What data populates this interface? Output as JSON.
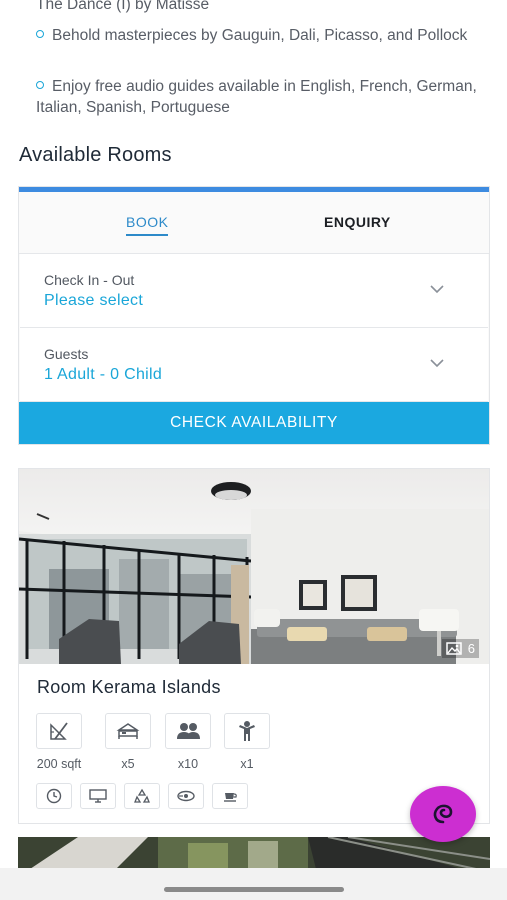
{
  "intro": {
    "top_line": "The Dance (I) by Matisse",
    "bullets": [
      "Behold masterpieces by Gauguin, Dali, Picasso, and Pollock",
      "Enjoy free audio guides available in English, French, German, Italian, Spanish, Portuguese"
    ]
  },
  "section_title": "Available Rooms",
  "booking": {
    "tabs": {
      "book": "BOOK",
      "enquiry": "ENQUIRY"
    },
    "active_tab": "BOOK",
    "check_in_out": {
      "label": "Check In - Out",
      "value": "Please select"
    },
    "guests": {
      "label": "Guests",
      "value": "1 Adult - 0 Child"
    },
    "check_button": "CHECK AVAILABILITY"
  },
  "room": {
    "name": "Room Kerama Islands",
    "photo_count": "6",
    "specs": [
      {
        "icon": "area-icon",
        "caption": "200 sqft"
      },
      {
        "icon": "bed-icon",
        "caption": "x5"
      },
      {
        "icon": "adults-icon",
        "caption": "x10"
      },
      {
        "icon": "child-icon",
        "caption": "x1"
      }
    ],
    "amenities": [
      "clock-icon",
      "tv-icon",
      "recycle-icon",
      "fan-icon",
      "coffee-icon"
    ]
  },
  "colors": {
    "accent": "#1ba8e0",
    "tab_active": "#2d8ac9",
    "top_border": "#3d8be0",
    "fab": "#cc2ed1"
  }
}
